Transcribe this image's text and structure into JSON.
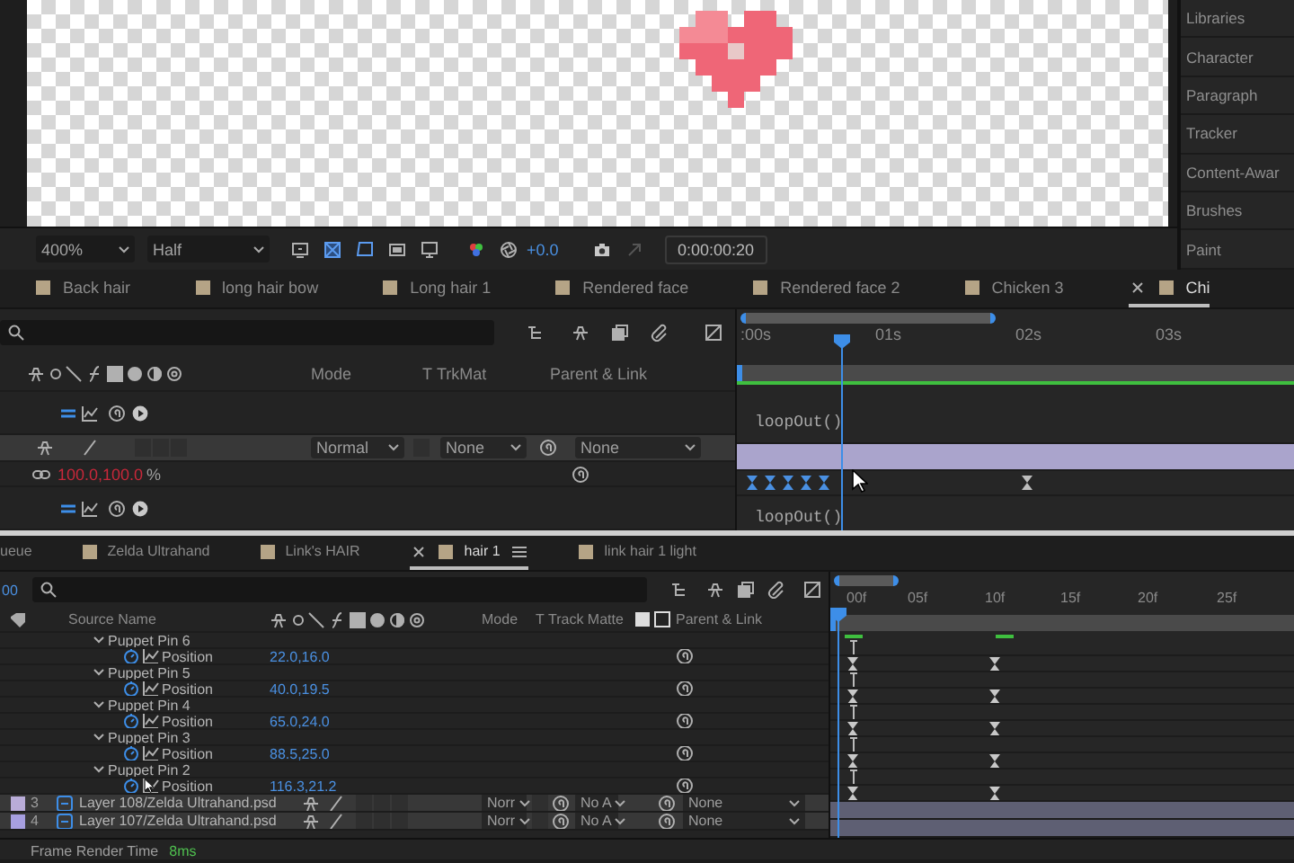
{
  "viewer": {
    "zoom": "400%",
    "resolution": "Half",
    "exposure": "+0.0",
    "timecode": "0:00:00:20"
  },
  "side_panels": [
    {
      "label": "Libraries"
    },
    {
      "label": "Character"
    },
    {
      "label": "Paragraph"
    },
    {
      "label": "Tracker"
    },
    {
      "label": "Content-Awar"
    },
    {
      "label": "Brushes"
    },
    {
      "label": "Paint"
    }
  ],
  "timeline_top": {
    "tabs": [
      {
        "kind": "composition",
        "label": "Back hair",
        "selected": false
      },
      {
        "kind": "composition",
        "label": "long hair bow",
        "selected": false
      },
      {
        "kind": "composition",
        "label": "Long hair 1",
        "selected": false
      },
      {
        "kind": "composition",
        "label": "Rendered face",
        "selected": false
      },
      {
        "kind": "composition",
        "label": "Rendered face 2",
        "selected": false
      },
      {
        "kind": "composition",
        "label": "Chicken 3",
        "selected": false
      },
      {
        "kind": "composition",
        "label": "Chi",
        "selected": true
      }
    ],
    "ruler": [
      ":00s",
      "01s",
      "02s",
      "03s"
    ],
    "columns": [
      {
        "kind": "mode",
        "label": "Mode"
      },
      {
        "kind": "t",
        "label": "T"
      },
      {
        "kind": "matte",
        "label": "TrkMat"
      },
      {
        "kind": "parent",
        "label": "Parent & Link"
      }
    ],
    "rows": [
      {
        "kind": "expression",
        "expression": "loopOut()"
      },
      {
        "kind": "layer",
        "mode": "Normal",
        "matte": "None",
        "parent": "None"
      },
      {
        "kind": "property",
        "value": "100.0,100.0",
        "unit": "%"
      },
      {
        "kind": "expression",
        "expression": "loopOut()"
      }
    ]
  },
  "timeline_bottom": {
    "current_time": "00",
    "tabs": [
      {
        "kind": "queue",
        "label": "ueue",
        "selected": false
      },
      {
        "kind": "composition",
        "label": "Zelda Ultrahand",
        "selected": false
      },
      {
        "kind": "composition",
        "label": "Link's HAIR",
        "selected": false
      },
      {
        "kind": "composition",
        "label": "hair 1",
        "selected": true
      },
      {
        "kind": "composition",
        "label": "link hair 1 light",
        "selected": false
      }
    ],
    "ruler": [
      "00f",
      "05f",
      "10f",
      "15f",
      "20f",
      "25f"
    ],
    "columns": [
      {
        "kind": "source",
        "label": "Source Name"
      },
      {
        "kind": "mode",
        "label": "Mode"
      },
      {
        "kind": "t",
        "label": "T"
      },
      {
        "kind": "matte",
        "label": "Track Matte"
      },
      {
        "kind": "parent",
        "label": "Parent & Link"
      }
    ],
    "rows": [
      {
        "kind": "pin",
        "name": "Puppet Pin 6",
        "expanded": true
      },
      {
        "kind": "position",
        "name": "Position",
        "value": "22.0,16.0"
      },
      {
        "kind": "pin",
        "name": "Puppet Pin 5",
        "expanded": true
      },
      {
        "kind": "position",
        "name": "Position",
        "value": "40.0,19.5"
      },
      {
        "kind": "pin",
        "name": "Puppet Pin 4",
        "expanded": true
      },
      {
        "kind": "position",
        "name": "Position",
        "value": "65.0,24.0"
      },
      {
        "kind": "pin",
        "name": "Puppet Pin 3",
        "expanded": true
      },
      {
        "kind": "position",
        "name": "Position",
        "value": "88.5,25.0"
      },
      {
        "kind": "pin",
        "name": "Puppet Pin 2",
        "expanded": true
      },
      {
        "kind": "position",
        "name": "Position",
        "value": "116.3,21.2"
      },
      {
        "kind": "layer",
        "number": "3",
        "name": "Layer 108/Zelda Ultrahand.psd",
        "color": "#b9acd8",
        "mode": "Norr",
        "matte": "No A",
        "parent": "None"
      },
      {
        "kind": "layer",
        "number": "4",
        "name": "Layer 107/Zelda Ultrahand.psd",
        "color": "#a79fe0",
        "mode": "Norr",
        "matte": "No A",
        "parent": "None"
      }
    ],
    "footer": {
      "label": "Frame Render Time",
      "value": "8ms"
    }
  }
}
